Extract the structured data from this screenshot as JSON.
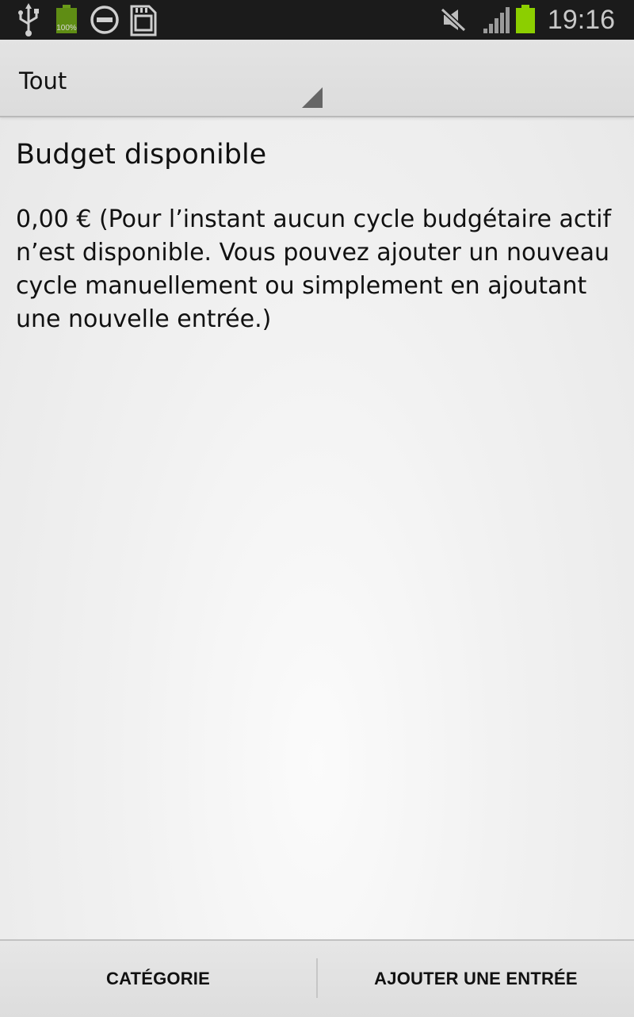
{
  "status_bar": {
    "time": "19:16",
    "battery_small_label": "100%",
    "icons": [
      "usb-icon",
      "battery-full-icon",
      "do-not-disturb-icon",
      "sd-card-icon",
      "mute-icon",
      "signal-icon",
      "battery-icon"
    ],
    "colors": {
      "background": "#1b1b1b",
      "battery": "#8ccf00"
    }
  },
  "filter_spinner": {
    "selected": "Tout"
  },
  "budget": {
    "title": "Budget disponible",
    "text": "0,00 € (Pour l’instant aucun cycle budgétaire actif n’est disponible. Vous pouvez ajouter un nouveau cycle manuellement ou simplement en ajoutant une nouvelle entrée.)"
  },
  "bottom_bar": {
    "category_label": "CATÉGORIE",
    "add_entry_label": "AJOUTER UNE ENTRÉE"
  }
}
